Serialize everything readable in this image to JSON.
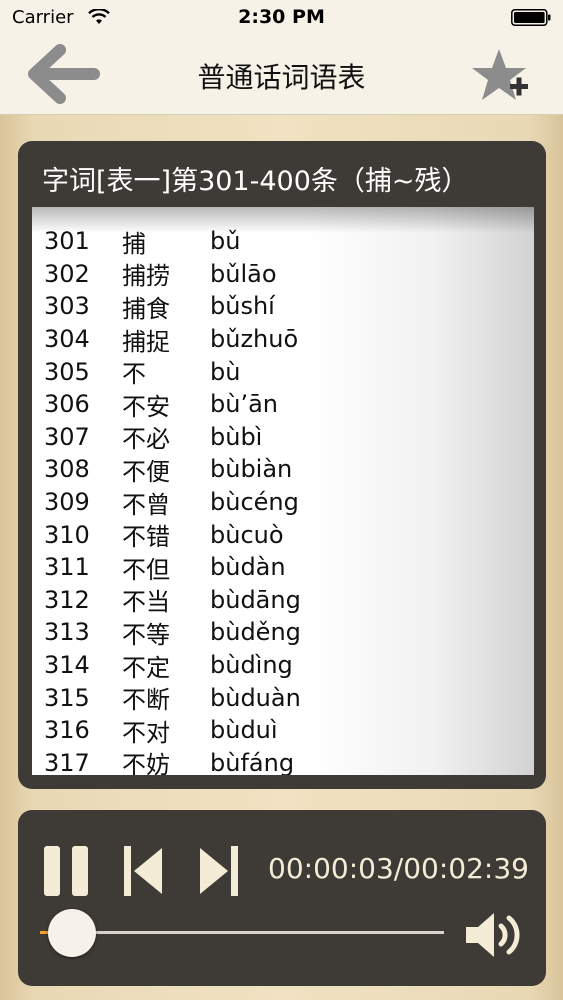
{
  "status": {
    "carrier": "Carrier",
    "time": "2:30 PM"
  },
  "nav": {
    "title": "普通话词语表"
  },
  "panel": {
    "title": "字词[表一]第301-400条（捕~残）",
    "rows": [
      {
        "num": "301",
        "word": "捕",
        "pinyin": "bǔ"
      },
      {
        "num": "302",
        "word": "捕捞",
        "pinyin": "bǔlāo"
      },
      {
        "num": "303",
        "word": "捕食",
        "pinyin": "bǔshí"
      },
      {
        "num": "304",
        "word": "捕捉",
        "pinyin": "bǔzhuō"
      },
      {
        "num": "305",
        "word": "不",
        "pinyin": "bù"
      },
      {
        "num": "306",
        "word": "不安",
        "pinyin": "bù’ān"
      },
      {
        "num": "307",
        "word": "不必",
        "pinyin": "bùbì"
      },
      {
        "num": "308",
        "word": "不便",
        "pinyin": "bùbiàn"
      },
      {
        "num": "309",
        "word": "不曾",
        "pinyin": "bùcéng"
      },
      {
        "num": "310",
        "word": "不错",
        "pinyin": "bùcuò"
      },
      {
        "num": "311",
        "word": "不但",
        "pinyin": "bùdàn"
      },
      {
        "num": "312",
        "word": "不当",
        "pinyin": "bùdāng"
      },
      {
        "num": "313",
        "word": "不等",
        "pinyin": "bùděng"
      },
      {
        "num": "314",
        "word": "不定",
        "pinyin": "bùdìng"
      },
      {
        "num": "315",
        "word": "不断",
        "pinyin": "bùduàn"
      },
      {
        "num": "316",
        "word": "不对",
        "pinyin": "bùduì"
      },
      {
        "num": "317",
        "word": "不妨",
        "pinyin": "bùfáng"
      }
    ]
  },
  "player": {
    "time_readout": "00:00:03/00:02:39",
    "progress_fraction": 0.019
  },
  "colors": {
    "panel_bg": "#3e3a35",
    "accent": "#f0a030",
    "control_fg": "#f4ecd6"
  },
  "icons": {
    "back": "arrow-left-icon",
    "favorite": "star-plus-icon",
    "pause": "pause-icon",
    "previous": "skip-previous-icon",
    "next": "skip-next-icon",
    "volume": "speaker-volume-icon"
  }
}
